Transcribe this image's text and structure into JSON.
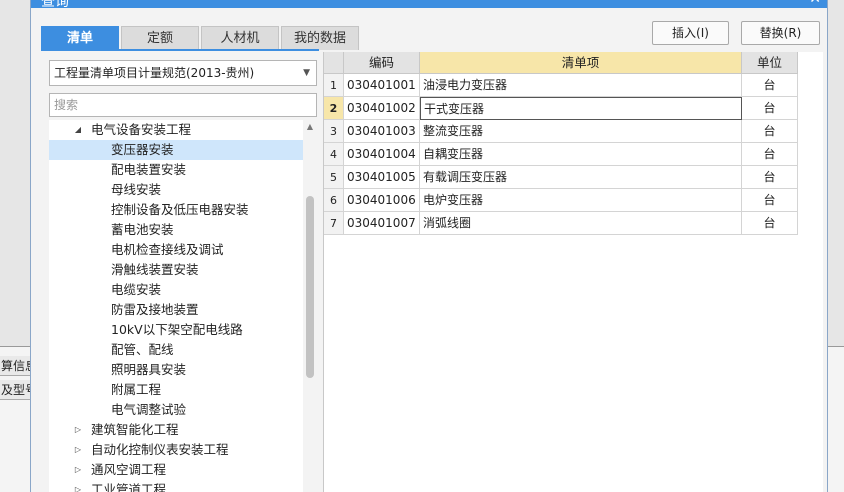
{
  "background": {
    "tab1": "算信息",
    "tab2": "及型号"
  },
  "dialog": {
    "title": "查询",
    "close": "✕"
  },
  "tabs": [
    {
      "label": "清单",
      "active": true
    },
    {
      "label": "定额",
      "active": false
    },
    {
      "label": "人材机",
      "active": false
    },
    {
      "label": "我的数据",
      "active": false
    }
  ],
  "buttons": {
    "insert": "插入(I)",
    "replace": "替换(R)"
  },
  "left_panel": {
    "spec_select": "工程量清单项目计量规范(2013-贵州)",
    "search_placeholder": "搜索",
    "tree": [
      {
        "label": "电气设备安装工程",
        "twisty": "◢",
        "level": 1,
        "selected": false
      },
      {
        "label": "变压器安装",
        "twisty": "",
        "level": 2,
        "selected": true
      },
      {
        "label": "配电装置安装",
        "twisty": "",
        "level": 2,
        "selected": false
      },
      {
        "label": "母线安装",
        "twisty": "",
        "level": 2,
        "selected": false
      },
      {
        "label": "控制设备及低压电器安装",
        "twisty": "",
        "level": 2,
        "selected": false
      },
      {
        "label": "蓄电池安装",
        "twisty": "",
        "level": 2,
        "selected": false
      },
      {
        "label": "电机检查接线及调试",
        "twisty": "",
        "level": 2,
        "selected": false
      },
      {
        "label": "滑触线装置安装",
        "twisty": "",
        "level": 2,
        "selected": false
      },
      {
        "label": "电缆安装",
        "twisty": "",
        "level": 2,
        "selected": false
      },
      {
        "label": "防雷及接地装置",
        "twisty": "",
        "level": 2,
        "selected": false
      },
      {
        "label": "10kV以下架空配电线路",
        "twisty": "",
        "level": 2,
        "selected": false
      },
      {
        "label": "配管、配线",
        "twisty": "",
        "level": 2,
        "selected": false
      },
      {
        "label": "照明器具安装",
        "twisty": "",
        "level": 2,
        "selected": false
      },
      {
        "label": "附属工程",
        "twisty": "",
        "level": 2,
        "selected": false
      },
      {
        "label": "电气调整试验",
        "twisty": "",
        "level": 2,
        "selected": false
      },
      {
        "label": "建筑智能化工程",
        "twisty": "▷",
        "level": 1,
        "selected": false
      },
      {
        "label": "自动化控制仪表安装工程",
        "twisty": "▷",
        "level": 1,
        "selected": false
      },
      {
        "label": "通风空调工程",
        "twisty": "▷",
        "level": 1,
        "selected": false
      },
      {
        "label": "工业管道工程",
        "twisty": "▷",
        "level": 1,
        "selected": false
      }
    ]
  },
  "table": {
    "columns": [
      "",
      "编码",
      "清单项",
      "单位"
    ],
    "rows": [
      {
        "num": "1",
        "code": "030401001",
        "name": "油浸电力变压器",
        "unit": "台"
      },
      {
        "num": "2",
        "code": "030401002",
        "name": "干式变压器",
        "unit": "台"
      },
      {
        "num": "3",
        "code": "030401003",
        "name": "整流变压器",
        "unit": "台"
      },
      {
        "num": "4",
        "code": "030401004",
        "name": "自耦变压器",
        "unit": "台"
      },
      {
        "num": "5",
        "code": "030401005",
        "name": "有载调压变压器",
        "unit": "台"
      },
      {
        "num": "6",
        "code": "030401006",
        "name": "电炉变压器",
        "unit": "台"
      },
      {
        "num": "7",
        "code": "030401007",
        "name": "消弧线圈",
        "unit": "台"
      }
    ],
    "current_row": 1
  }
}
